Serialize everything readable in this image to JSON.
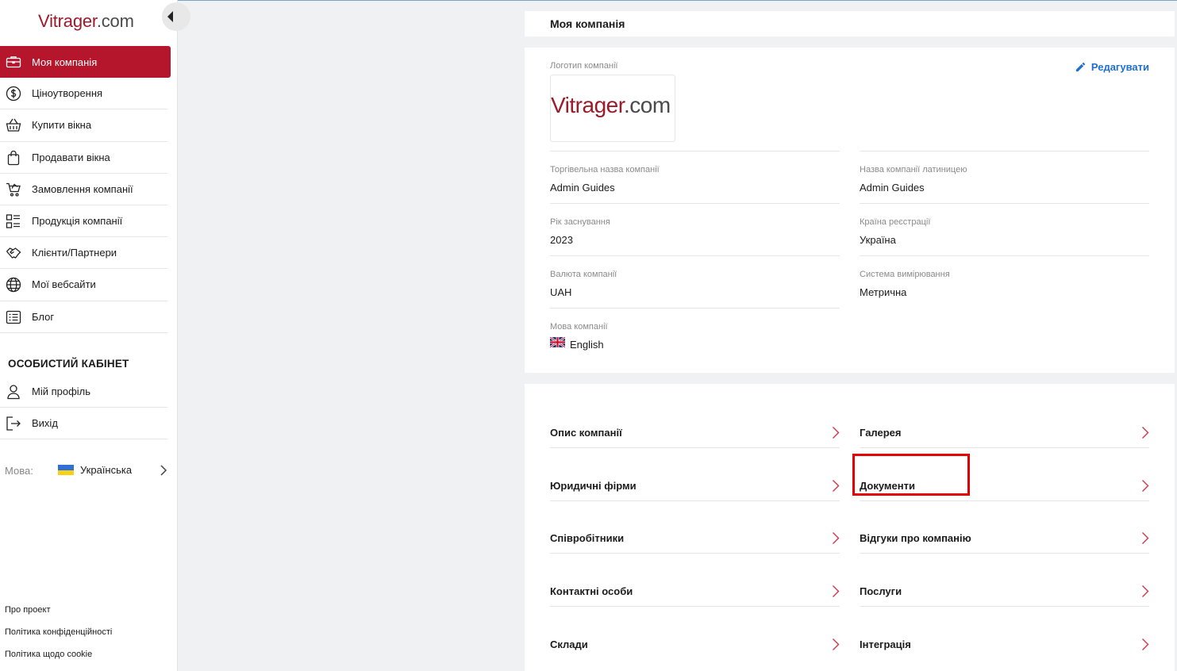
{
  "sidebar": {
    "logo": {
      "brand": "Vitrager",
      "suffix": ".com"
    },
    "menu": [
      {
        "label": "Моя компанія",
        "icon": "briefcase-icon",
        "active": true
      },
      {
        "label": "Ціноутворення",
        "icon": "dollar-circle-icon"
      },
      {
        "label": "Купити вікна",
        "icon": "basket-icon"
      },
      {
        "label": "Продавати вікна",
        "icon": "shopping-bag-icon"
      },
      {
        "label": "Замовлення компанії",
        "icon": "cart-icon"
      },
      {
        "label": "Продукція компанії",
        "icon": "list-grid-icon"
      },
      {
        "label": "Клієнти/Партнери",
        "icon": "handshake-icon"
      },
      {
        "label": "Мої вебсайти",
        "icon": "globe-icon"
      },
      {
        "label": "Блог",
        "icon": "document-list-icon"
      }
    ],
    "section_title": "ОСОБИСТИЙ КАБІНЕТ",
    "personal_menu": [
      {
        "label": "Мій профіль",
        "icon": "user-icon"
      },
      {
        "label": "Вихід",
        "icon": "logout-icon"
      }
    ],
    "language": {
      "label": "Мова:",
      "value": "Українська",
      "flag_colors": [
        "#2f6fd6",
        "#f7d117"
      ]
    },
    "footer_links": [
      "Про проект",
      "Політика конфіденційності",
      "Політика щодо cookie"
    ]
  },
  "main": {
    "title": "Моя компанія",
    "edit_label": "Редагувати",
    "logo_label": "Логотип компанії",
    "logo_image": {
      "brand": "Vitrager",
      "suffix": ".com"
    },
    "fields": {
      "trade_name": {
        "label": "Торгівельна назва компанії",
        "value": "Admin Guides"
      },
      "latin_name": {
        "label": "Назва компанії латиницею",
        "value": "Admin Guides"
      },
      "founded": {
        "label": "Рік заснування",
        "value": "2023"
      },
      "country": {
        "label": "Країна реєстрації",
        "value": "Україна"
      },
      "currency": {
        "label": "Валюта компанії",
        "value": "UAH"
      },
      "measurement": {
        "label": "Система вимірювання",
        "value": "Метрична"
      },
      "language": {
        "label": "Мова компанії",
        "value": "English"
      }
    },
    "links": [
      "Опис компанії",
      "Галерея",
      "Юридичні фірми",
      "Документи",
      "Співробітники",
      "Відгуки про компанію",
      "Контактні особи",
      "Послуги",
      "Склади",
      "Інтеграція"
    ]
  },
  "colors": {
    "accent": "#b5162b",
    "link": "#1e6fd1",
    "highlight": "#e20000"
  }
}
